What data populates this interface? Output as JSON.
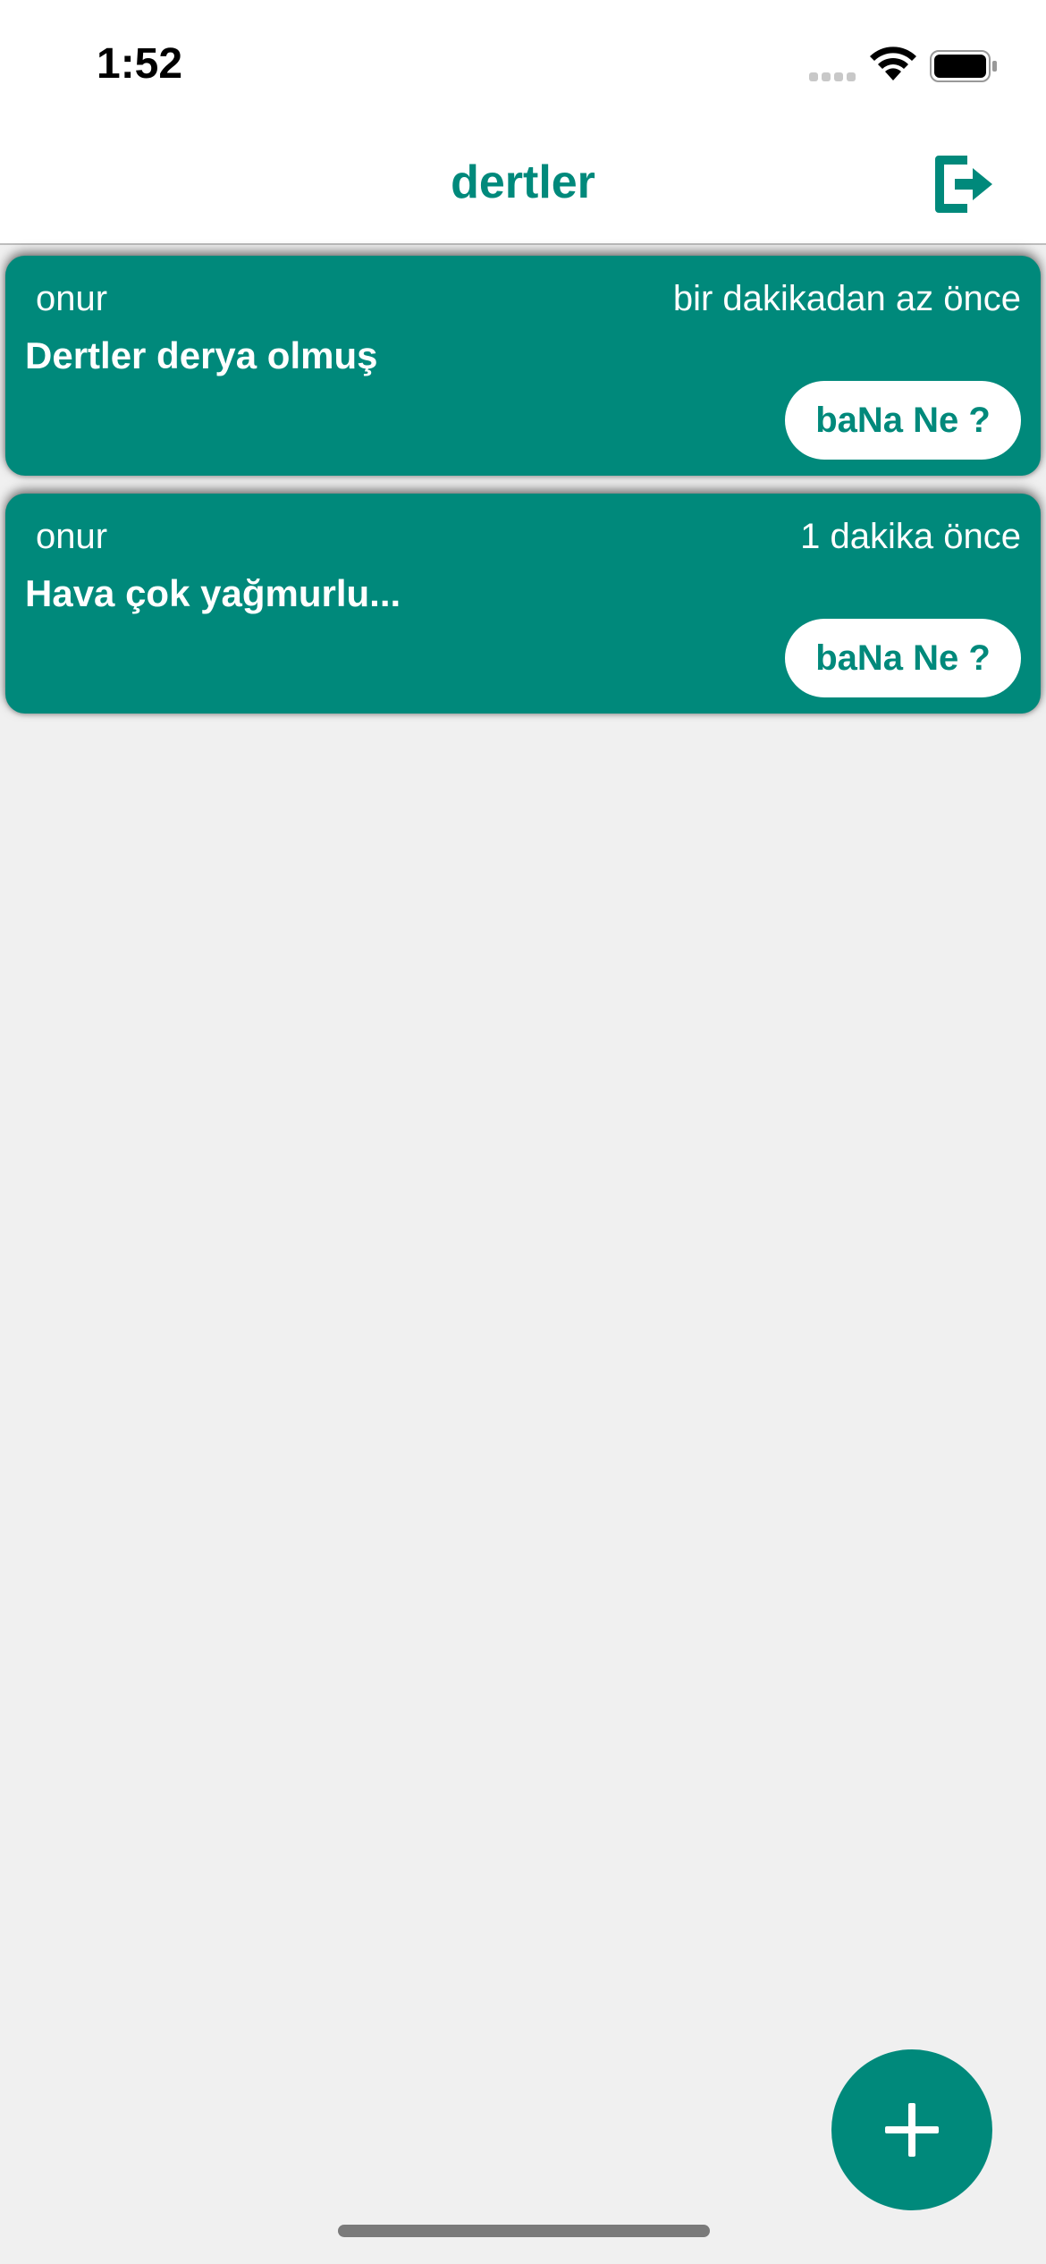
{
  "status_bar": {
    "time": "1:52"
  },
  "header": {
    "title": "dertler",
    "logout_icon": "logout-icon"
  },
  "posts": [
    {
      "author": "onur",
      "time": "bir dakikadan az önce",
      "text": "Dertler derya olmuş",
      "button_label": "baNa Ne ?"
    },
    {
      "author": "onur",
      "time": "1 dakika önce",
      "text": "Hava çok yağmurlu...",
      "button_label": "baNa Ne ?"
    }
  ],
  "fab": {
    "icon": "plus-icon"
  },
  "colors": {
    "accent": "#00897b",
    "background": "#f0f0f0",
    "surface": "#ffffff"
  }
}
